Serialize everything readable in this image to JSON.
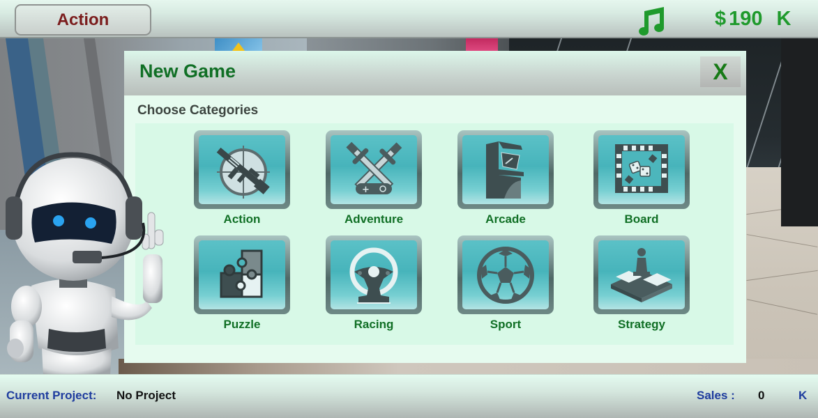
{
  "topbar": {
    "current_category": "Action",
    "music_icon": "music-note-icon",
    "money": {
      "currency": "$",
      "amount": "190",
      "unit": "K"
    }
  },
  "dialog": {
    "title": "New Game",
    "close_label": "X",
    "subtitle": "Choose Categories",
    "categories": [
      {
        "label": "Action",
        "icon": "rifle-crosshair-icon"
      },
      {
        "label": "Adventure",
        "icon": "crossed-swords-gamepad-icon"
      },
      {
        "label": "Arcade",
        "icon": "arcade-cabinet-icon"
      },
      {
        "label": "Board",
        "icon": "board-game-dice-icon"
      },
      {
        "label": "Puzzle",
        "icon": "puzzle-pieces-icon"
      },
      {
        "label": "Racing",
        "icon": "steering-wheel-icon"
      },
      {
        "label": "Sport",
        "icon": "soccer-ball-icon"
      },
      {
        "label": "Strategy",
        "icon": "chess-pawn-board-icon"
      }
    ]
  },
  "status": {
    "project_label": "Current Project:",
    "project_value": "No Project",
    "sales_label": "Sales :",
    "sales_value": "0",
    "sales_unit": "K"
  },
  "colors": {
    "accent_green": "#106f25",
    "money_green": "#1f9a2c",
    "category_red": "#7a1c1c",
    "label_blue": "#1e3c9e",
    "tile_teal": "#47b4bb",
    "icon_slate": "#4a5c5e"
  }
}
